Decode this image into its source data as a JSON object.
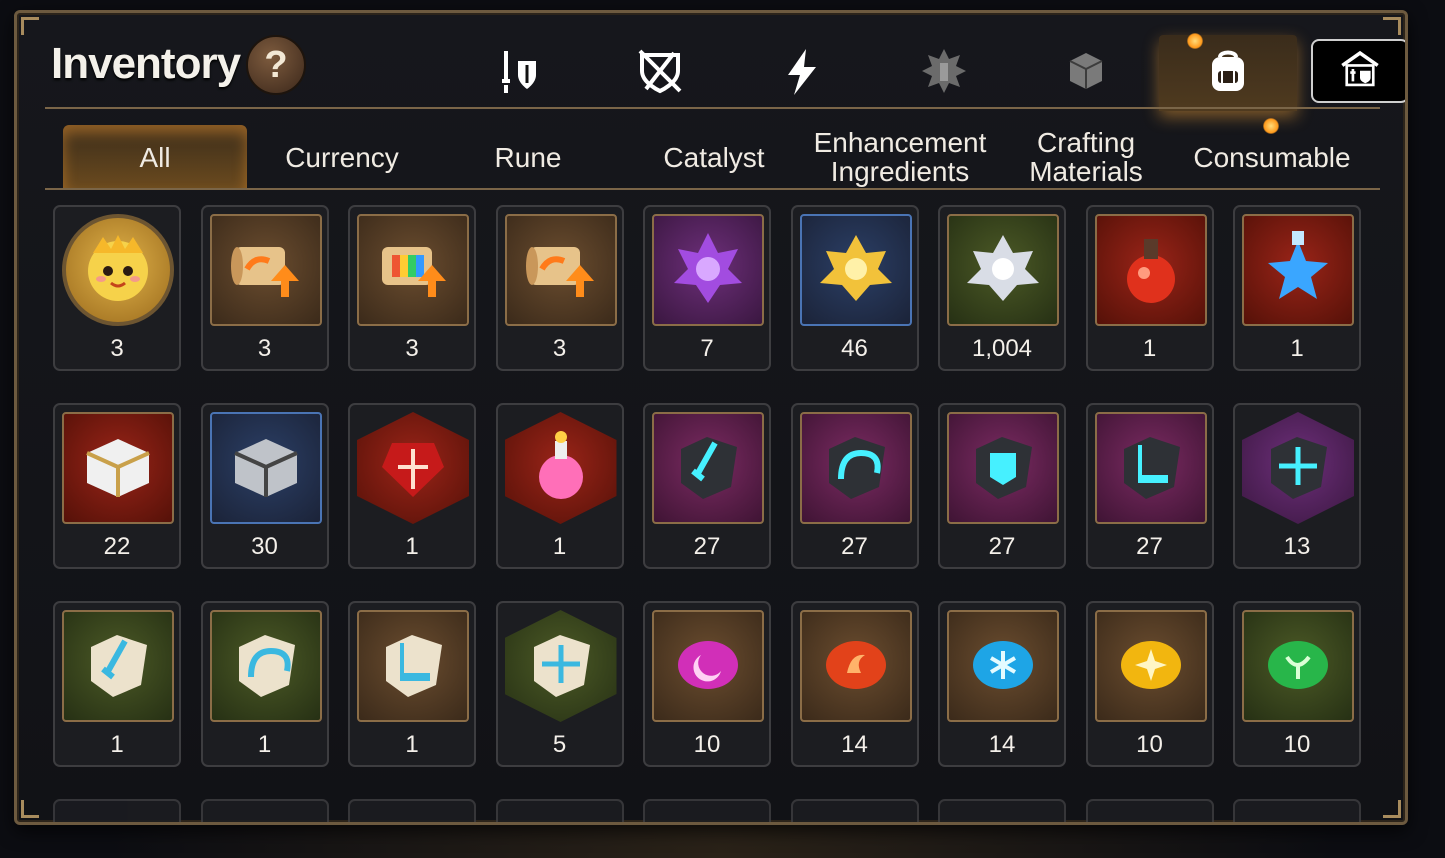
{
  "header": {
    "title": "Inventory",
    "help_label": "?"
  },
  "category_buttons": [
    {
      "icon": "sword-shield-icon",
      "active": false
    },
    {
      "icon": "broken-shield-icon",
      "active": false
    },
    {
      "icon": "lightning-icon",
      "active": false
    },
    {
      "icon": "splash-emblem-icon",
      "active": false
    },
    {
      "icon": "box-icon",
      "active": false
    },
    {
      "icon": "backpack-icon",
      "active": true
    },
    {
      "icon": "storage-house-icon",
      "active": false
    }
  ],
  "tabs": [
    {
      "label": "All",
      "active": true
    },
    {
      "label": "Currency",
      "active": false
    },
    {
      "label": "Rune",
      "active": false
    },
    {
      "label": "Catalyst",
      "active": false
    },
    {
      "label": "Enhancement\nIngredients",
      "active": false
    },
    {
      "label": "Crafting\nMaterials",
      "active": false
    },
    {
      "label": "Consumable",
      "active": false
    }
  ],
  "items": [
    [
      {
        "count": "3",
        "icon": "mascot-icon",
        "shape": "round",
        "bg": "bg-gold"
      },
      {
        "count": "3",
        "icon": "scroll-upgrade-icon",
        "shape": "square",
        "bg": "bg-brown"
      },
      {
        "count": "3",
        "icon": "rainbow-scroll-icon",
        "shape": "square",
        "bg": "bg-brown"
      },
      {
        "count": "3",
        "icon": "scroll-upgrade-icon",
        "shape": "square",
        "bg": "bg-brown"
      },
      {
        "count": "7",
        "icon": "purple-crystal-icon",
        "shape": "square",
        "bg": "bg-purple"
      },
      {
        "count": "46",
        "icon": "gold-crystal-icon",
        "shape": "square",
        "bg": "bg-blue"
      },
      {
        "count": "1,004",
        "icon": "silver-crystal-icon",
        "shape": "square",
        "bg": "bg-green"
      },
      {
        "count": "1",
        "icon": "red-potion-icon",
        "shape": "square",
        "bg": "bg-red"
      },
      {
        "count": "1",
        "icon": "star-potion-icon",
        "shape": "square",
        "bg": "bg-red"
      }
    ],
    [
      {
        "count": "22",
        "icon": "gold-chest-icon",
        "shape": "square",
        "bg": "bg-red"
      },
      {
        "count": "30",
        "icon": "silver-chest-icon",
        "shape": "square",
        "bg": "bg-blue"
      },
      {
        "count": "1",
        "icon": "red-gem-icon",
        "shape": "hex",
        "bg": "bg-red"
      },
      {
        "count": "1",
        "icon": "pink-potion-icon",
        "shape": "hex",
        "bg": "bg-red"
      },
      {
        "count": "27",
        "icon": "sword-rune-stone-icon",
        "shape": "square",
        "bg": "bg-magenta"
      },
      {
        "count": "27",
        "icon": "helmet-rune-stone-icon",
        "shape": "square",
        "bg": "bg-magenta"
      },
      {
        "count": "27",
        "icon": "armor-rune-stone-icon",
        "shape": "square",
        "bg": "bg-magenta"
      },
      {
        "count": "27",
        "icon": "boot-rune-stone-icon",
        "shape": "square",
        "bg": "bg-magenta"
      },
      {
        "count": "13",
        "icon": "star-rune-stone-icon",
        "shape": "hex",
        "bg": "bg-purple"
      }
    ],
    [
      {
        "count": "1",
        "icon": "sword-rune-pebble-icon",
        "shape": "square",
        "bg": "bg-green"
      },
      {
        "count": "1",
        "icon": "helmet-rune-pebble-icon",
        "shape": "square",
        "bg": "bg-green"
      },
      {
        "count": "1",
        "icon": "boot-rune-pebble-icon",
        "shape": "square",
        "bg": "bg-brown"
      },
      {
        "count": "5",
        "icon": "star-rune-pebble-icon",
        "shape": "hex",
        "bg": "bg-green"
      },
      {
        "count": "10",
        "icon": "moon-orb-icon",
        "shape": "square",
        "bg": "bg-brown"
      },
      {
        "count": "14",
        "icon": "fire-orb-icon",
        "shape": "square",
        "bg": "bg-brown"
      },
      {
        "count": "14",
        "icon": "ice-orb-icon",
        "shape": "square",
        "bg": "bg-brown"
      },
      {
        "count": "10",
        "icon": "light-orb-icon",
        "shape": "square",
        "bg": "bg-brown"
      },
      {
        "count": "10",
        "icon": "earth-orb-icon",
        "shape": "square",
        "bg": "bg-green"
      }
    ]
  ],
  "colors": {
    "accent_gold": "#e5a43a",
    "panel_border": "#6d5a3f",
    "text": "#f4f0ea"
  }
}
